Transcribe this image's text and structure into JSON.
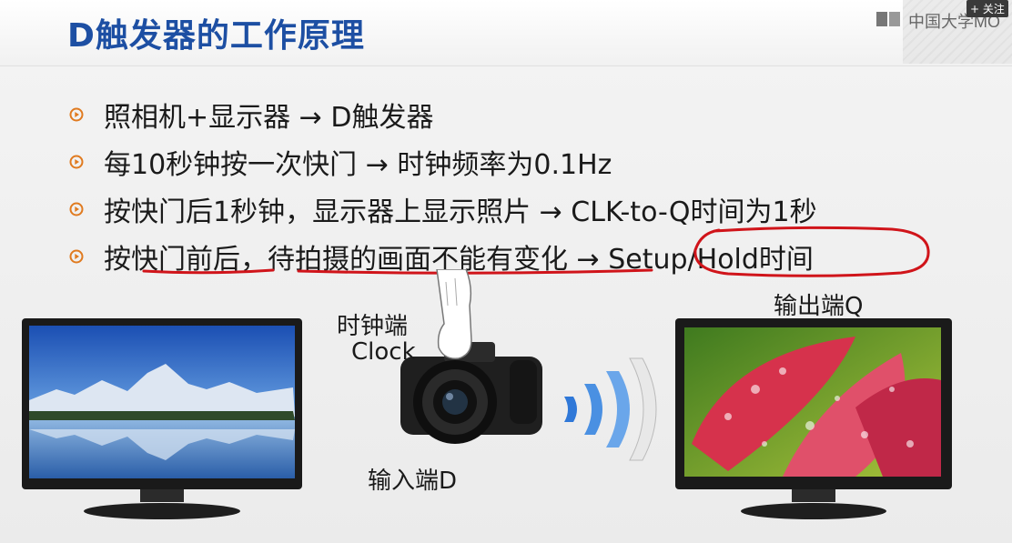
{
  "title": "D触发器的工作原理",
  "watermark": {
    "text": "中国大学MO",
    "follow": "+ 关注"
  },
  "bullets": [
    "照相机+显示器 → D触发器",
    "每10秒钟按一次快门 → 时钟频率为0.1Hz",
    "按快门后1秒钟，显示器上显示照片 → CLK-to-Q时间为1秒",
    "按快门前后，待拍摄的画面不能有变化 → Setup/Hold时间"
  ],
  "diagram": {
    "clock_label_line1": "时钟端",
    "clock_label_line2": "Clock",
    "input_label": "输入端D",
    "output_label": "输出端Q"
  },
  "colors": {
    "title": "#1d4fa3",
    "annotation": "#d0141a",
    "bullet_icon": "#e07a1f"
  }
}
